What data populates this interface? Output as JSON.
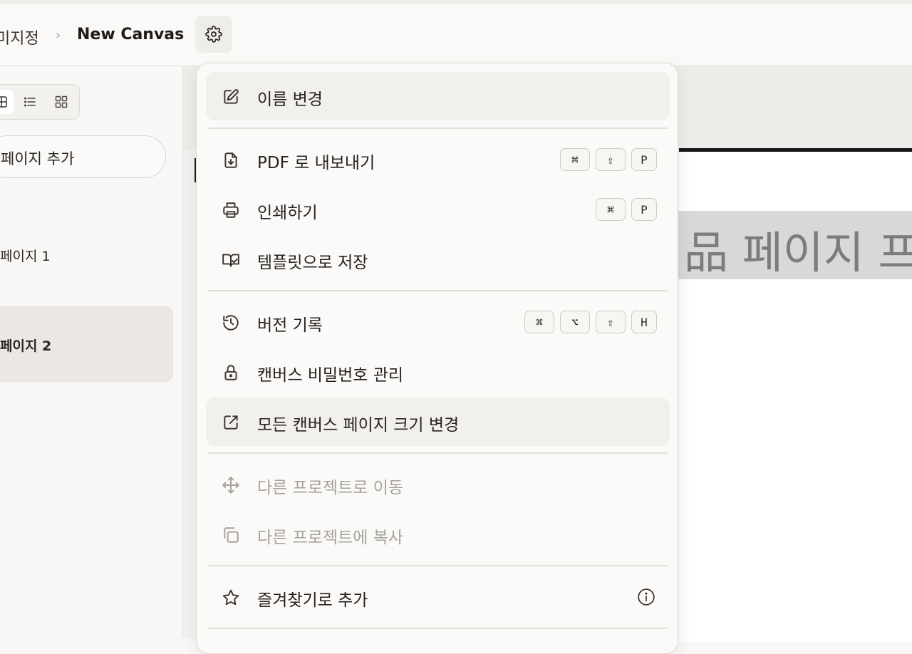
{
  "header": {
    "breadcrumb_parent": "미지정",
    "breadcrumb_separator": "›",
    "title": "New Canvas",
    "settings_icon": "gear-icon"
  },
  "sidebar": {
    "view_modes": [
      "grid-icon",
      "list-icon",
      "grid-small-icon"
    ],
    "add_page_label": "페이지 추가",
    "pages": [
      {
        "label": "페이지 1",
        "selected": false
      },
      {
        "label": "페이지 2",
        "selected": true
      }
    ]
  },
  "canvas": {
    "banner_text": "品 페이지 프"
  },
  "menu": {
    "items": [
      {
        "id": "rename",
        "label": "이름 변경",
        "icon": "pencil-square-icon",
        "highlighted": true,
        "disabled": false,
        "shortcut": []
      },
      {
        "id": "export-pdf",
        "label": "PDF 로 내보내기",
        "icon": "file-download-icon",
        "highlighted": false,
        "disabled": false,
        "shortcut": [
          "⌘",
          "⇧",
          "P"
        ]
      },
      {
        "id": "print",
        "label": "인쇄하기",
        "icon": "printer-icon",
        "highlighted": false,
        "disabled": false,
        "shortcut": [
          "⌘",
          "P"
        ]
      },
      {
        "id": "save-template",
        "label": "템플릿으로 저장",
        "icon": "book-check-icon",
        "highlighted": false,
        "disabled": false,
        "shortcut": []
      },
      {
        "id": "version-history",
        "label": "버전 기록",
        "icon": "history-icon",
        "highlighted": false,
        "disabled": false,
        "shortcut": [
          "⌘",
          "⌥",
          "⇧",
          "H"
        ]
      },
      {
        "id": "password",
        "label": "캔버스 비밀번호 관리",
        "icon": "lock-icon",
        "highlighted": false,
        "disabled": false,
        "shortcut": []
      },
      {
        "id": "resize-all",
        "label": "모든 캔버스 페이지 크기 변경",
        "icon": "external-resize-icon",
        "highlighted": true,
        "disabled": false,
        "shortcut": []
      },
      {
        "id": "move-project",
        "label": "다른 프로젝트로 이동",
        "icon": "move-arrows-icon",
        "highlighted": false,
        "disabled": true,
        "shortcut": []
      },
      {
        "id": "copy-project",
        "label": "다른 프로젝트에 복사",
        "icon": "copy-icon",
        "highlighted": false,
        "disabled": true,
        "shortcut": []
      },
      {
        "id": "favorite",
        "label": "즐겨찾기로 추가",
        "icon": "star-icon",
        "highlighted": false,
        "disabled": false,
        "shortcut": [],
        "info_icon": "info-circle-icon"
      }
    ]
  }
}
